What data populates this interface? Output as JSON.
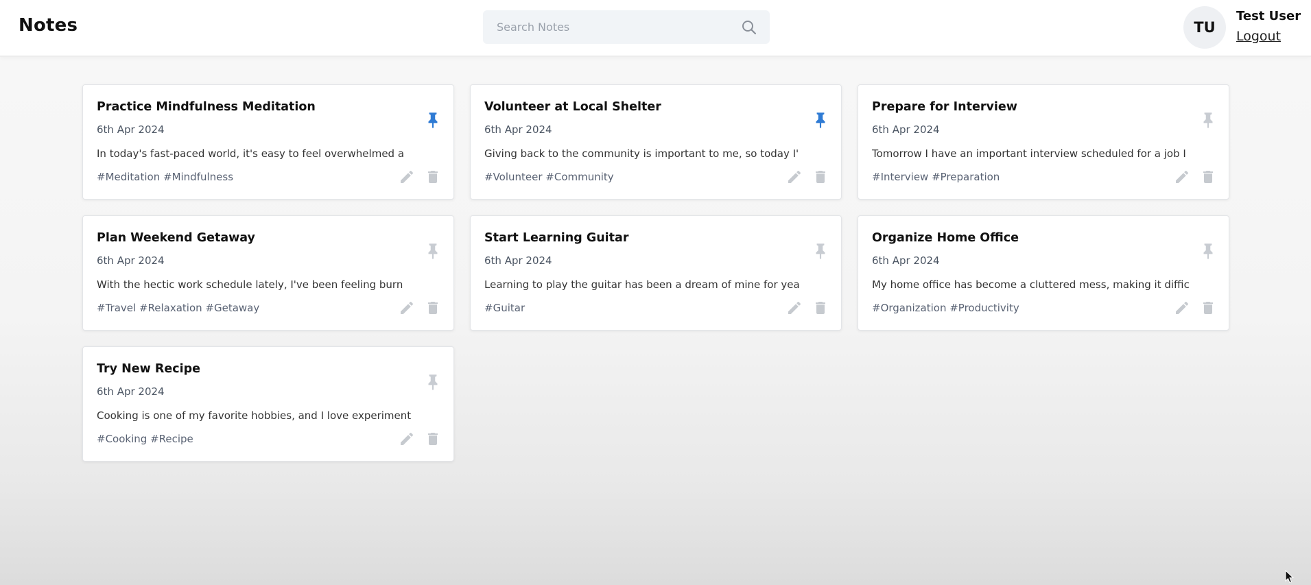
{
  "header": {
    "title": "Notes",
    "search": {
      "placeholder": "Search Notes",
      "value": "",
      "icon": "search-icon"
    },
    "user": {
      "initials": "TU",
      "name": "Test User",
      "logout_label": "Logout"
    }
  },
  "colors": {
    "pin_active": "#2f7bd4",
    "pin_inactive": "#c8ccd2",
    "action_icon": "#c6cacf",
    "card_border": "#e3e5e8",
    "background": "#f4f4f4"
  },
  "notes": [
    {
      "title": "Practice Mindfulness Meditation",
      "date": "6th Apr 2024",
      "content": "In today's fast-paced world, it's easy to feel overwhelmed a",
      "tags": "#Meditation #Mindfulness",
      "pinned": true
    },
    {
      "title": "Volunteer at Local Shelter",
      "date": "6th Apr 2024",
      "content": "Giving back to the community is important to me, so today I'",
      "tags": "#Volunteer #Community",
      "pinned": true
    },
    {
      "title": "Prepare for Interview",
      "date": "6th Apr 2024",
      "content": "Tomorrow I have an important interview scheduled for a job I",
      "tags": "#Interview #Preparation",
      "pinned": false
    },
    {
      "title": "Plan Weekend Getaway",
      "date": "6th Apr 2024",
      "content": "With the hectic work schedule lately, I've been feeling burn",
      "tags": "#Travel #Relaxation #Getaway",
      "pinned": false
    },
    {
      "title": "Start Learning Guitar",
      "date": "6th Apr 2024",
      "content": "Learning to play the guitar has been a dream of mine for yea",
      "tags": "#Guitar",
      "pinned": false
    },
    {
      "title": "Organize Home Office",
      "date": "6th Apr 2024",
      "content": "My home office has become a cluttered mess, making it diffic",
      "tags": "#Organization #Productivity",
      "pinned": false
    },
    {
      "title": "Try New Recipe",
      "date": "6th Apr 2024",
      "content": "Cooking is one of my favorite hobbies, and I love experiment",
      "tags": "#Cooking #Recipe",
      "pinned": false
    }
  ]
}
